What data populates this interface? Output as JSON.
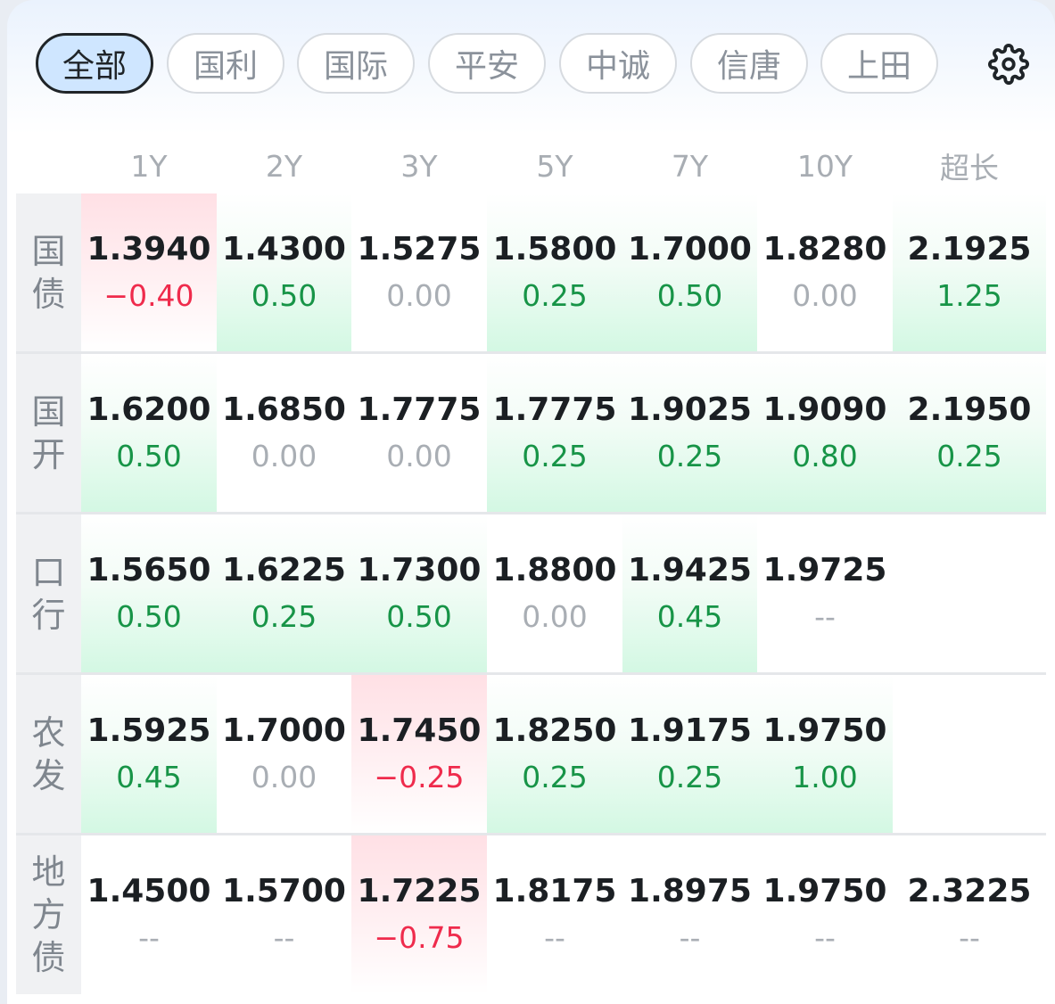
{
  "tabs": [
    "全部",
    "国利",
    "国际",
    "平安",
    "中诚",
    "信唐",
    "上田"
  ],
  "active_tab": 0,
  "columns": [
    "1Y",
    "2Y",
    "3Y",
    "5Y",
    "7Y",
    "10Y",
    "超长"
  ],
  "rows": [
    {
      "label": [
        "国",
        "债"
      ],
      "cells": [
        {
          "val": "1.3940",
          "chg": "−0.40",
          "dir": "down",
          "bg": "red"
        },
        {
          "val": "1.4300",
          "chg": "0.50",
          "dir": "up",
          "bg": "green"
        },
        {
          "val": "1.5275",
          "chg": "0.00",
          "dir": "flat",
          "bg": ""
        },
        {
          "val": "1.5800",
          "chg": "0.25",
          "dir": "up",
          "bg": "green"
        },
        {
          "val": "1.7000",
          "chg": "0.50",
          "dir": "up",
          "bg": "green"
        },
        {
          "val": "1.8280",
          "chg": "0.00",
          "dir": "flat",
          "bg": ""
        },
        {
          "val": "2.1925",
          "chg": "1.25",
          "dir": "up",
          "bg": "green"
        }
      ]
    },
    {
      "label": [
        "国",
        "开"
      ],
      "cells": [
        {
          "val": "1.6200",
          "chg": "0.50",
          "dir": "up",
          "bg": "green"
        },
        {
          "val": "1.6850",
          "chg": "0.00",
          "dir": "flat",
          "bg": ""
        },
        {
          "val": "1.7775",
          "chg": "0.00",
          "dir": "flat",
          "bg": ""
        },
        {
          "val": "1.7775",
          "chg": "0.25",
          "dir": "up",
          "bg": "green"
        },
        {
          "val": "1.9025",
          "chg": "0.25",
          "dir": "up",
          "bg": "green"
        },
        {
          "val": "1.9090",
          "chg": "0.80",
          "dir": "up",
          "bg": "green"
        },
        {
          "val": "2.1950",
          "chg": "0.25",
          "dir": "up",
          "bg": "green"
        }
      ]
    },
    {
      "label": [
        "口",
        "行"
      ],
      "cells": [
        {
          "val": "1.5650",
          "chg": "0.50",
          "dir": "up",
          "bg": "green"
        },
        {
          "val": "1.6225",
          "chg": "0.25",
          "dir": "up",
          "bg": "green"
        },
        {
          "val": "1.7300",
          "chg": "0.50",
          "dir": "up",
          "bg": "green"
        },
        {
          "val": "1.8800",
          "chg": "0.00",
          "dir": "flat",
          "bg": ""
        },
        {
          "val": "1.9425",
          "chg": "0.45",
          "dir": "up",
          "bg": "green"
        },
        {
          "val": "1.9725",
          "chg": "--",
          "dir": "flat",
          "bg": ""
        },
        null
      ]
    },
    {
      "label": [
        "农",
        "发"
      ],
      "cells": [
        {
          "val": "1.5925",
          "chg": "0.45",
          "dir": "up",
          "bg": "green"
        },
        {
          "val": "1.7000",
          "chg": "0.00",
          "dir": "flat",
          "bg": ""
        },
        {
          "val": "1.7450",
          "chg": "−0.25",
          "dir": "down",
          "bg": "red"
        },
        {
          "val": "1.8250",
          "chg": "0.25",
          "dir": "up",
          "bg": "green"
        },
        {
          "val": "1.9175",
          "chg": "0.25",
          "dir": "up",
          "bg": "green"
        },
        {
          "val": "1.9750",
          "chg": "1.00",
          "dir": "up",
          "bg": "green"
        },
        null
      ]
    },
    {
      "label": [
        "地",
        "方",
        "债"
      ],
      "cells": [
        {
          "val": "1.4500",
          "chg": "--",
          "dir": "flat",
          "bg": ""
        },
        {
          "val": "1.5700",
          "chg": "--",
          "dir": "flat",
          "bg": ""
        },
        {
          "val": "1.7225",
          "chg": "−0.75",
          "dir": "down",
          "bg": "red"
        },
        {
          "val": "1.8175",
          "chg": "--",
          "dir": "flat",
          "bg": ""
        },
        {
          "val": "1.8975",
          "chg": "--",
          "dir": "flat",
          "bg": ""
        },
        {
          "val": "1.9750",
          "chg": "--",
          "dir": "flat",
          "bg": ""
        },
        {
          "val": "2.3225",
          "chg": "--",
          "dir": "flat",
          "bg": ""
        }
      ]
    }
  ],
  "colors": {
    "up": "#179447",
    "down": "#ef2b4c",
    "flat": "#a9aeb4",
    "accent": "#cfe6ff"
  },
  "icons": {
    "settings": "gear-icon"
  }
}
